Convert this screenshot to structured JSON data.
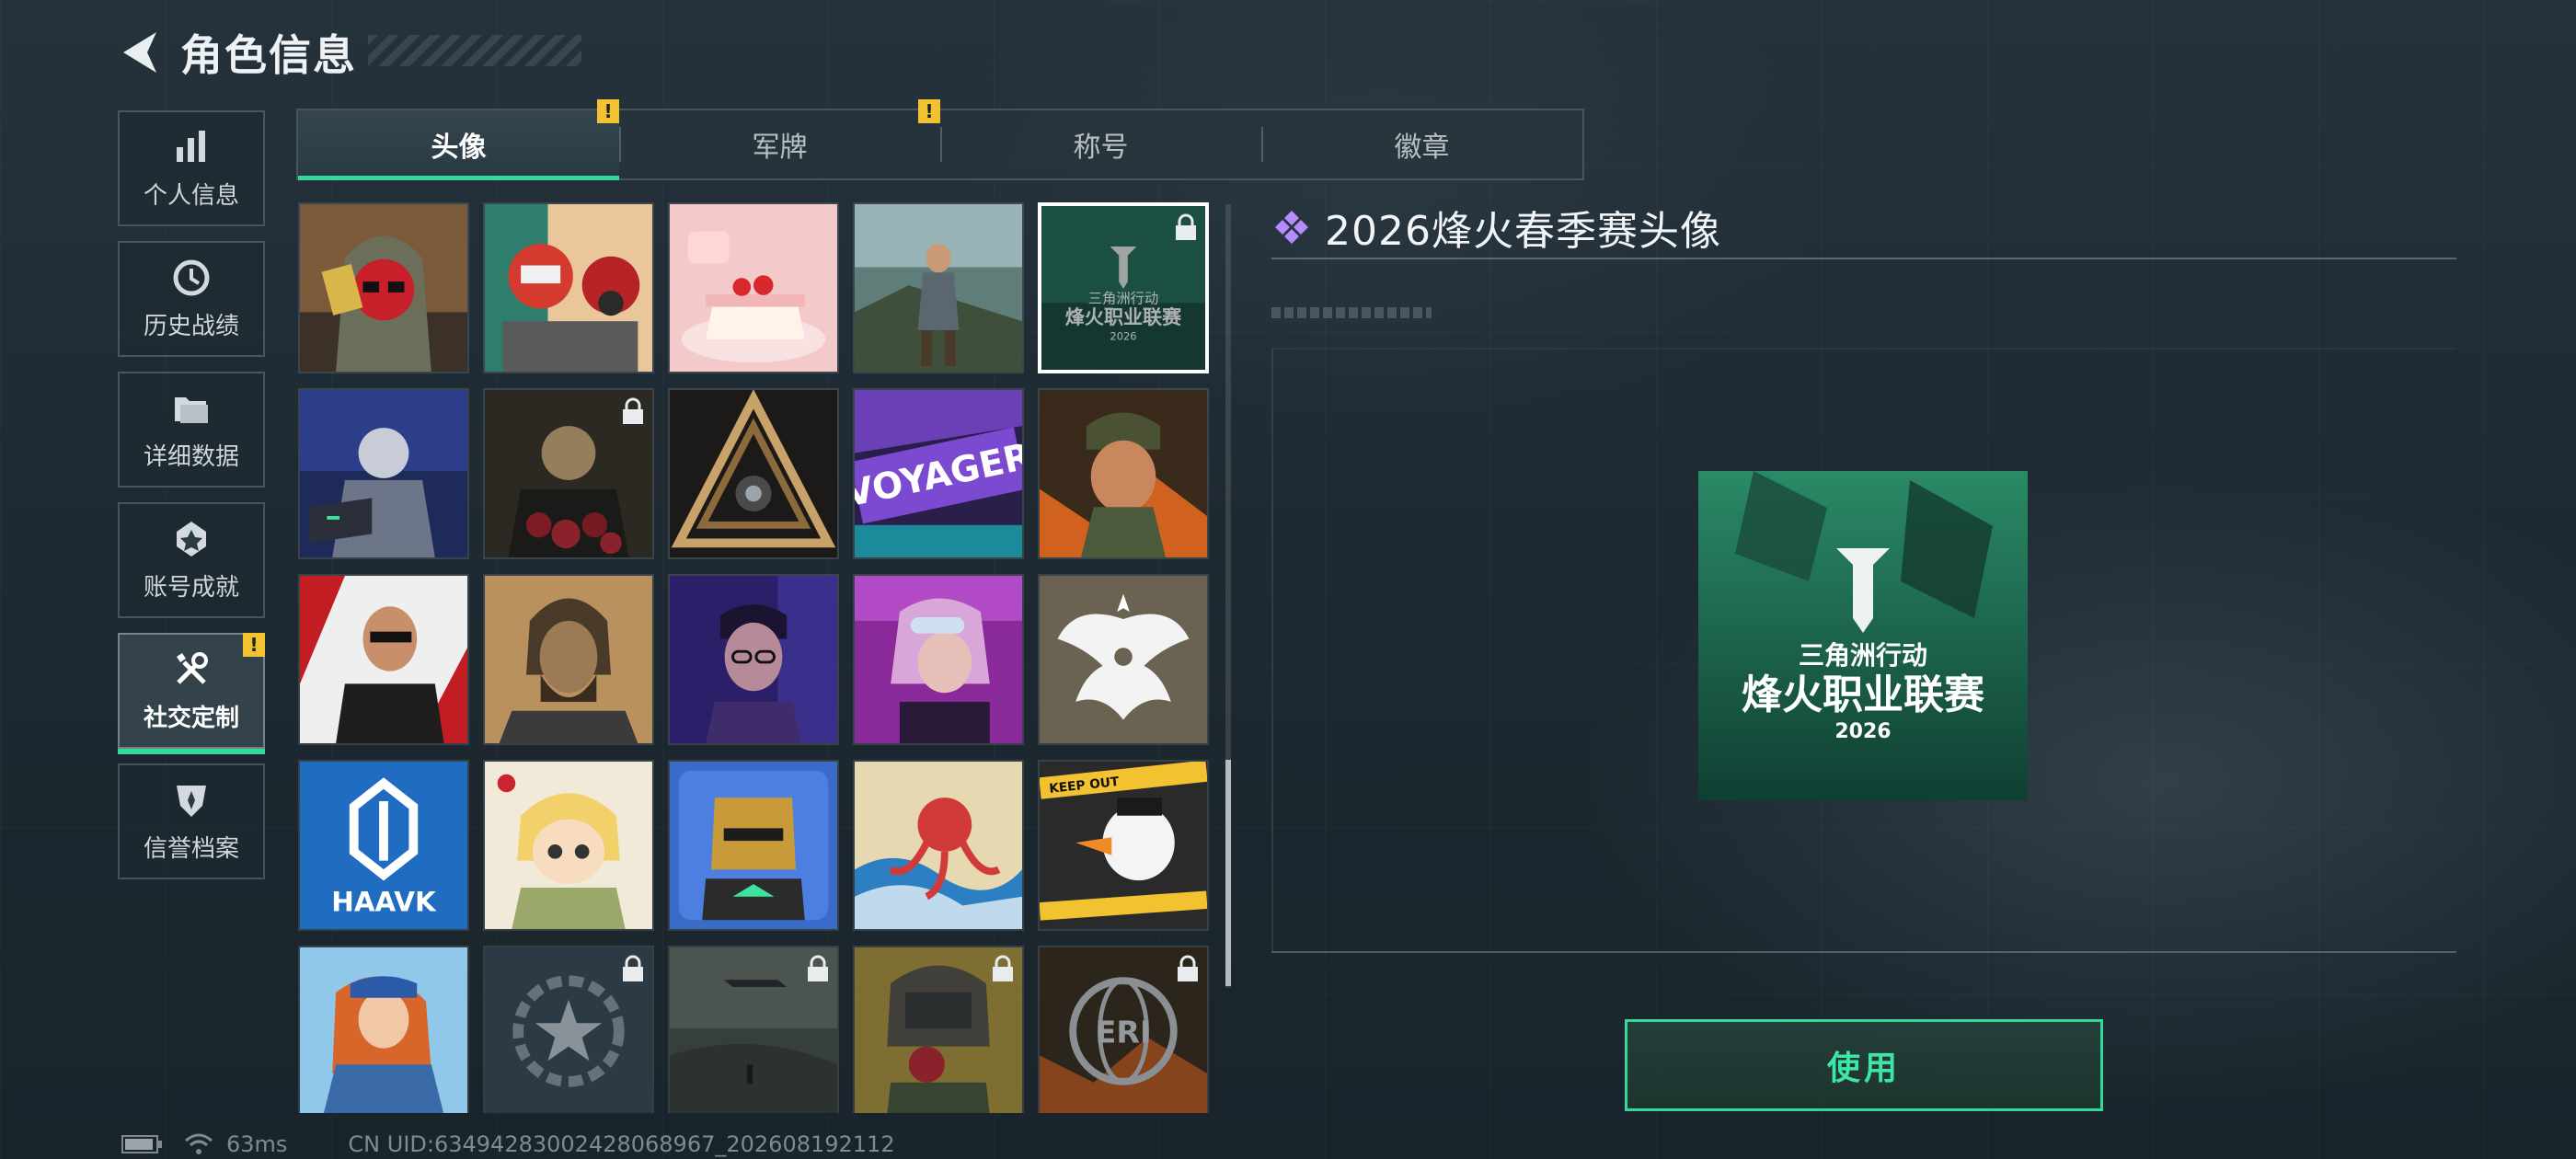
{
  "header": {
    "title": "角色信息"
  },
  "sidebar": {
    "items": [
      {
        "label": "个人信息",
        "icon": "bar-chart-icon"
      },
      {
        "label": "历史战绩",
        "icon": "history-icon"
      },
      {
        "label": "详细数据",
        "icon": "folder-icon"
      },
      {
        "label": "账号成就",
        "icon": "achievement-icon"
      },
      {
        "label": "社交定制",
        "icon": "tools-icon",
        "active": true,
        "alert": "!"
      },
      {
        "label": "信誉档案",
        "icon": "shield-icon"
      }
    ]
  },
  "tabs": [
    {
      "label": "头像",
      "active": true,
      "alert": "!"
    },
    {
      "label": "军牌",
      "alert": "!"
    },
    {
      "label": "称号"
    },
    {
      "label": "徽章"
    }
  ],
  "avatars": {
    "locked_indices": [
      4,
      6,
      21,
      22,
      23,
      24
    ],
    "selected_index": 4,
    "cards": {
      "selected_small": {
        "line1": "三角洲行动",
        "line2": "烽火职业联赛",
        "line3": "2026"
      },
      "voyager": "VOYAGER",
      "haavk": "HAAVK",
      "keep_out": "KEEP OUT",
      "eri": "ERI"
    }
  },
  "detail": {
    "title": "2026烽火春季赛头像",
    "preview": {
      "line1": "三角洲行动",
      "line2": "烽火职业联赛",
      "line3": "2026"
    },
    "use_button": "使用"
  },
  "status": {
    "ping": "63ms",
    "uid": "CN UID:63494283002428068967_202608192112"
  },
  "colors": {
    "accent": "#34d99a",
    "alert": "#f2c230",
    "diamond": "#b48cff"
  }
}
